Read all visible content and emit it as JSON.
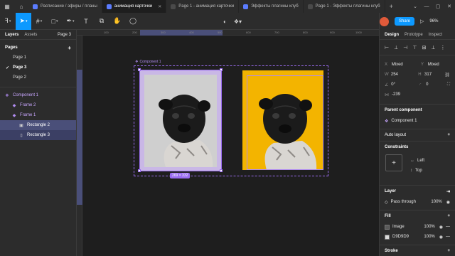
{
  "tabs": [
    {
      "label": "Расписание / эфиры / планы",
      "active": false
    },
    {
      "label": "анимация карточки",
      "active": true
    },
    {
      "label": "Page 1 - анимация карточки",
      "active": false
    },
    {
      "label": "Эффекты плагины клуб",
      "active": false
    },
    {
      "label": "Page 1 - Эффекты плагины клуб",
      "active": false
    }
  ],
  "toolbar": {
    "share_label": "Share",
    "zoom": "96%"
  },
  "left_panel": {
    "tab_layers": "Layers",
    "tab_assets": "Assets",
    "page_selector": "Page 3",
    "pages_heading": "Pages",
    "pages": [
      "Page 1",
      "Page 3",
      "Page 2"
    ],
    "current_page": "Page 3",
    "layers": [
      {
        "name": "Component 1",
        "icon": "component-icon",
        "indent": 0,
        "kind": "comp"
      },
      {
        "name": "Frame 2",
        "icon": "component-icon",
        "indent": 1,
        "kind": "comp"
      },
      {
        "name": "Frame 1",
        "icon": "component-icon",
        "indent": 1,
        "kind": "sel"
      },
      {
        "name": "Rectangle 2",
        "icon": "image-icon",
        "indent": 2,
        "kind": "sel"
      },
      {
        "name": "Rectangle 3",
        "icon": "rectangle-icon",
        "indent": 2,
        "kind": "sel"
      }
    ]
  },
  "ruler": {
    "ticks": [
      "100",
      "200",
      "300",
      "400",
      "500",
      "600",
      "700",
      "800",
      "900",
      "1000",
      "1100"
    ]
  },
  "canvas": {
    "component_label": "Component 1",
    "size_badge": "269 × 332",
    "frame2_color": "#f3b400",
    "frame1_bg": "#cfcfcf"
  },
  "right_panel": {
    "tab_design": "Design",
    "tab_prototype": "Prototype",
    "tab_inspect": "Inspect",
    "x_label": "X",
    "x_value": "Mixed",
    "y_label": "Y",
    "y_value": "Mixed",
    "w_label": "W",
    "w_value": "254",
    "h_label": "H",
    "h_value": "317",
    "rotation": "0°",
    "radius": "0",
    "clip_value": "-239",
    "parent_heading": "Parent component",
    "parent_name": "Component 1",
    "auto_layout": "Auto layout",
    "constraints_heading": "Constraints",
    "constraint_h": "Left",
    "constraint_v": "Top",
    "layer_heading": "Layer",
    "blend": "Pass through",
    "layer_opacity": "100%",
    "fill_heading": "Fill",
    "fills": [
      {
        "name": "Image",
        "opacity": "100%",
        "color": "#5a5a5a"
      },
      {
        "name": "D9D9D9",
        "opacity": "100%",
        "color": "#d9d9d9"
      }
    ],
    "stroke_heading": "Stroke"
  }
}
